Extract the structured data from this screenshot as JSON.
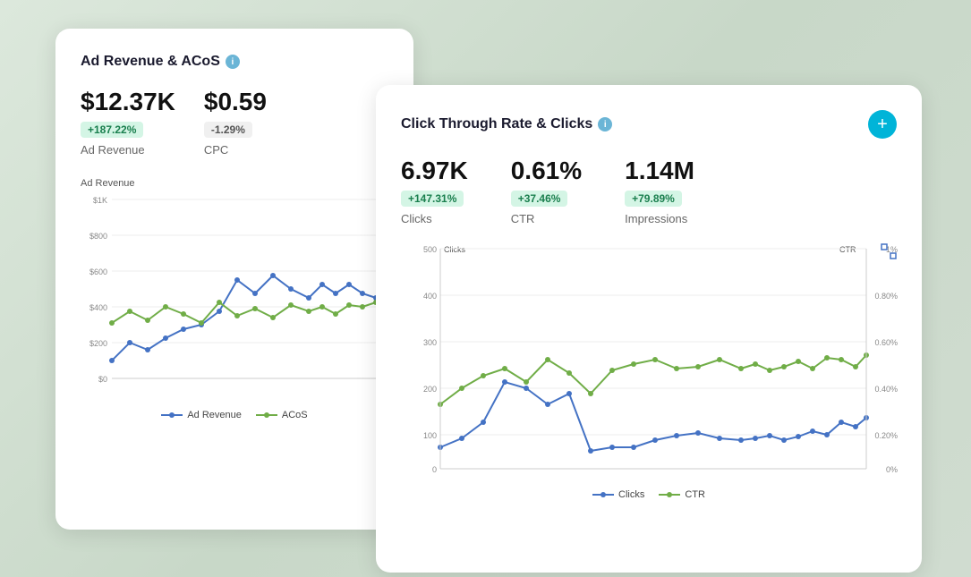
{
  "background": {
    "color": "#dde8dd"
  },
  "card_left": {
    "title": "Ad Revenue & ACoS",
    "info_icon": "i",
    "metrics": [
      {
        "value": "$12.37K",
        "badge": "+187.22%",
        "badge_type": "green",
        "label": "Ad Revenue"
      },
      {
        "value": "$0.59",
        "badge": "-1.29%",
        "badge_type": "gray",
        "label": "CPC"
      }
    ],
    "chart": {
      "title": "Ad Revenue",
      "y_axis": [
        "$1K",
        "$800",
        "$600",
        "$400",
        "$200",
        "$0"
      ],
      "legend": [
        "Ad Revenue",
        "ACoS"
      ]
    }
  },
  "card_right": {
    "title": "Click Through Rate & Clicks",
    "info_icon": "i",
    "add_button": "+",
    "metrics": [
      {
        "value": "6.97K",
        "badge": "+147.31%",
        "badge_type": "green",
        "label": "Clicks"
      },
      {
        "value": "0.61%",
        "badge": "+37.46%",
        "badge_type": "green",
        "label": "CTR"
      },
      {
        "value": "1.14M",
        "badge": "+79.89%",
        "badge_type": "green",
        "label": "Impressions"
      }
    ],
    "chart": {
      "left_axis_label": "Clicks",
      "right_axis_label": "CTR",
      "left_y_axis": [
        "500",
        "400",
        "300",
        "200",
        "100",
        "0"
      ],
      "right_y_axis": [
        "1%",
        "0.80%",
        "0.60%",
        "0.40%",
        "0.20%",
        "0%"
      ],
      "legend": [
        "Clicks",
        "CTR"
      ]
    }
  }
}
